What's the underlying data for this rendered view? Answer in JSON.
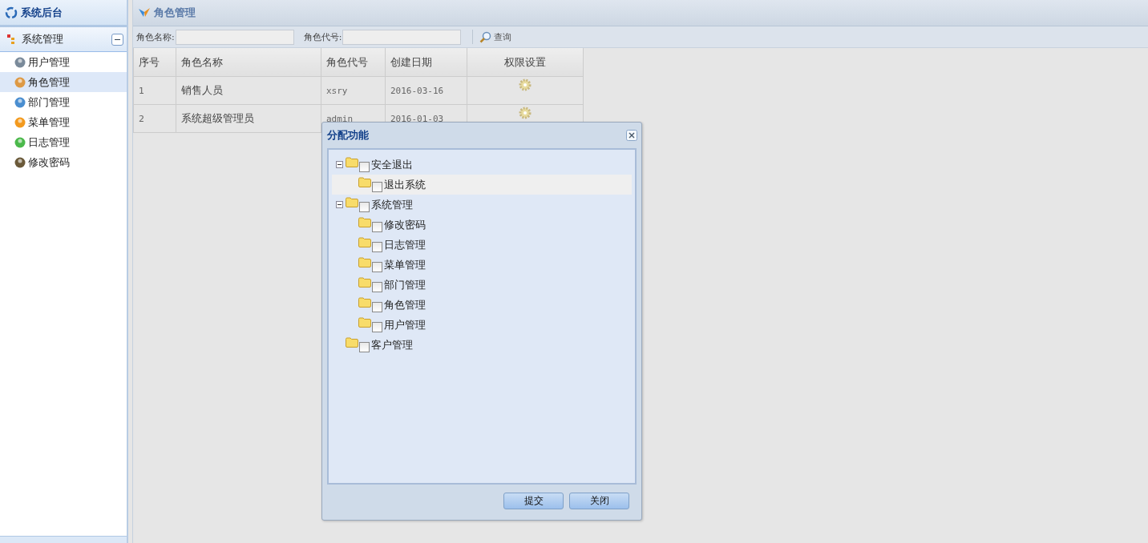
{
  "sidebar": {
    "title": "系统后台",
    "section": {
      "title": "系统管理",
      "expanded": true,
      "items": [
        {
          "label": "用户管理",
          "selected": false
        },
        {
          "label": "角色管理",
          "selected": true
        },
        {
          "label": "部门管理",
          "selected": false
        },
        {
          "label": "菜单管理",
          "selected": false
        },
        {
          "label": "日志管理",
          "selected": false
        },
        {
          "label": "修改密码",
          "selected": false
        }
      ]
    }
  },
  "main": {
    "title": "角色管理",
    "search": [
      {
        "label": "角色名称:"
      },
      {
        "label": "角色代号:"
      }
    ],
    "query_button": "查询",
    "table": {
      "columns": [
        "序号",
        "角色名称",
        "角色代号",
        "创建日期",
        "权限设置"
      ],
      "rows": [
        {
          "cells": [
            "1",
            "销售人员",
            "xsry",
            "2016-03-16"
          ]
        },
        {
          "cells": [
            "2",
            "系统超级管理员",
            "admin",
            "2016-01-03"
          ]
        }
      ]
    }
  },
  "dialog": {
    "title": "分配功能",
    "tree": [
      {
        "label": "安全退出",
        "checked": false,
        "selected": false,
        "expanded": true,
        "children": [
          {
            "label": "退出系统",
            "checked": false,
            "selected": true
          }
        ]
      },
      {
        "label": "系统管理",
        "checked": false,
        "selected": false,
        "expanded": true,
        "children": [
          {
            "label": "修改密码",
            "checked": false,
            "selected": false
          },
          {
            "label": "日志管理",
            "checked": false,
            "selected": false
          },
          {
            "label": "菜单管理",
            "checked": false,
            "selected": false
          },
          {
            "label": "部门管理",
            "checked": false,
            "selected": false
          },
          {
            "label": "角色管理",
            "checked": false,
            "selected": false
          },
          {
            "label": "用户管理",
            "checked": false,
            "selected": false
          }
        ]
      },
      {
        "label": "客户管理",
        "checked": false,
        "selected": false
      }
    ],
    "buttons": [
      "提交",
      "关闭"
    ]
  }
}
